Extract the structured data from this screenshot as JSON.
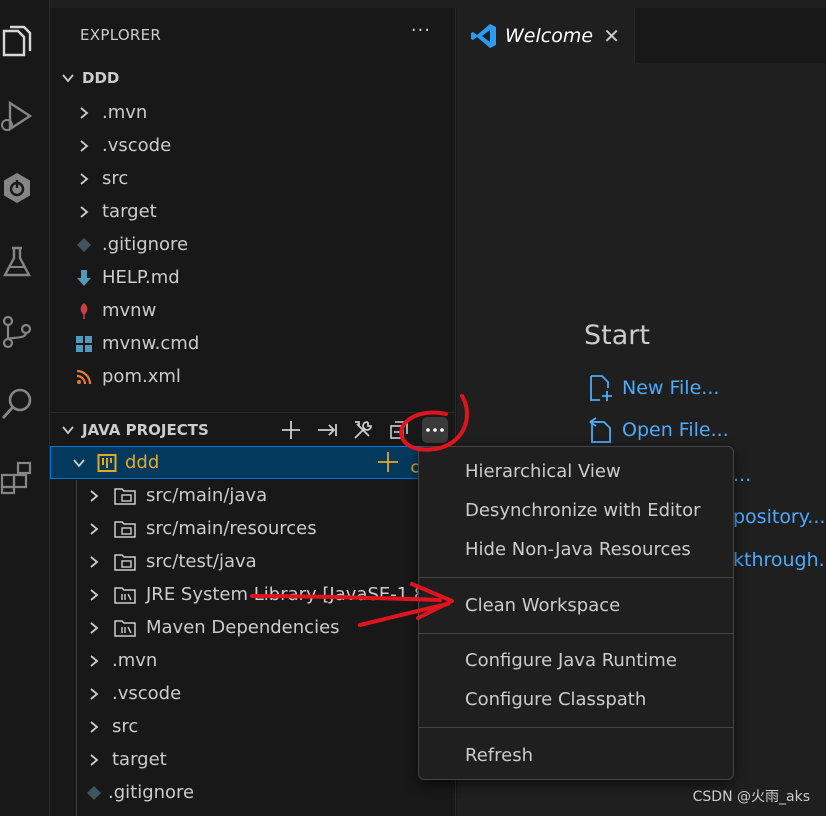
{
  "explorer": {
    "title": "EXPLORER",
    "more": "···",
    "workspace": "DDD",
    "items": [
      {
        "label": ".mvn",
        "kind": "folder"
      },
      {
        "label": ".vscode",
        "kind": "folder"
      },
      {
        "label": "src",
        "kind": "folder"
      },
      {
        "label": "target",
        "kind": "folder"
      },
      {
        "label": ".gitignore",
        "kind": "git"
      },
      {
        "label": "HELP.md",
        "kind": "markdown"
      },
      {
        "label": "mvnw",
        "kind": "shell"
      },
      {
        "label": "mvnw.cmd",
        "kind": "windows"
      },
      {
        "label": "pom.xml",
        "kind": "xml"
      }
    ]
  },
  "java_projects": {
    "title": "JAVA PROJECTS",
    "project": "ddd",
    "items": [
      {
        "label": "src/main/java",
        "kind": "package-folder"
      },
      {
        "label": "src/main/resources",
        "kind": "package-folder"
      },
      {
        "label": "src/test/java",
        "kind": "package-folder"
      },
      {
        "label": "JRE System Library [JavaSE-1.8]",
        "kind": "library"
      },
      {
        "label": "Maven Dependencies",
        "kind": "library"
      },
      {
        "label": ".mvn",
        "kind": "folder"
      },
      {
        "label": ".vscode",
        "kind": "folder"
      },
      {
        "label": "src",
        "kind": "folder"
      },
      {
        "label": "target",
        "kind": "folder"
      },
      {
        "label": ".gitignore",
        "kind": "git"
      }
    ]
  },
  "editor": {
    "tab_label": "Welcome",
    "tab_close": "✕",
    "start_title": "Start",
    "links": [
      "New File...",
      "Open File...",
      "...",
      "pository...",
      "kthrough..."
    ]
  },
  "context_menu": {
    "items": [
      "Hierarchical View",
      "Desynchronize with Editor",
      "Hide Non-Java Resources",
      "Clean Workspace",
      "Configure Java Runtime",
      "Configure Classpath",
      "Refresh"
    ]
  },
  "watermark": "CSDN @火雨_aks",
  "colors": {
    "accent_blue": "#4daafc",
    "selection": "#04395e",
    "focus_border": "#0078d4",
    "annotation_red": "#e0141e",
    "project_icon": "#e5a823"
  }
}
